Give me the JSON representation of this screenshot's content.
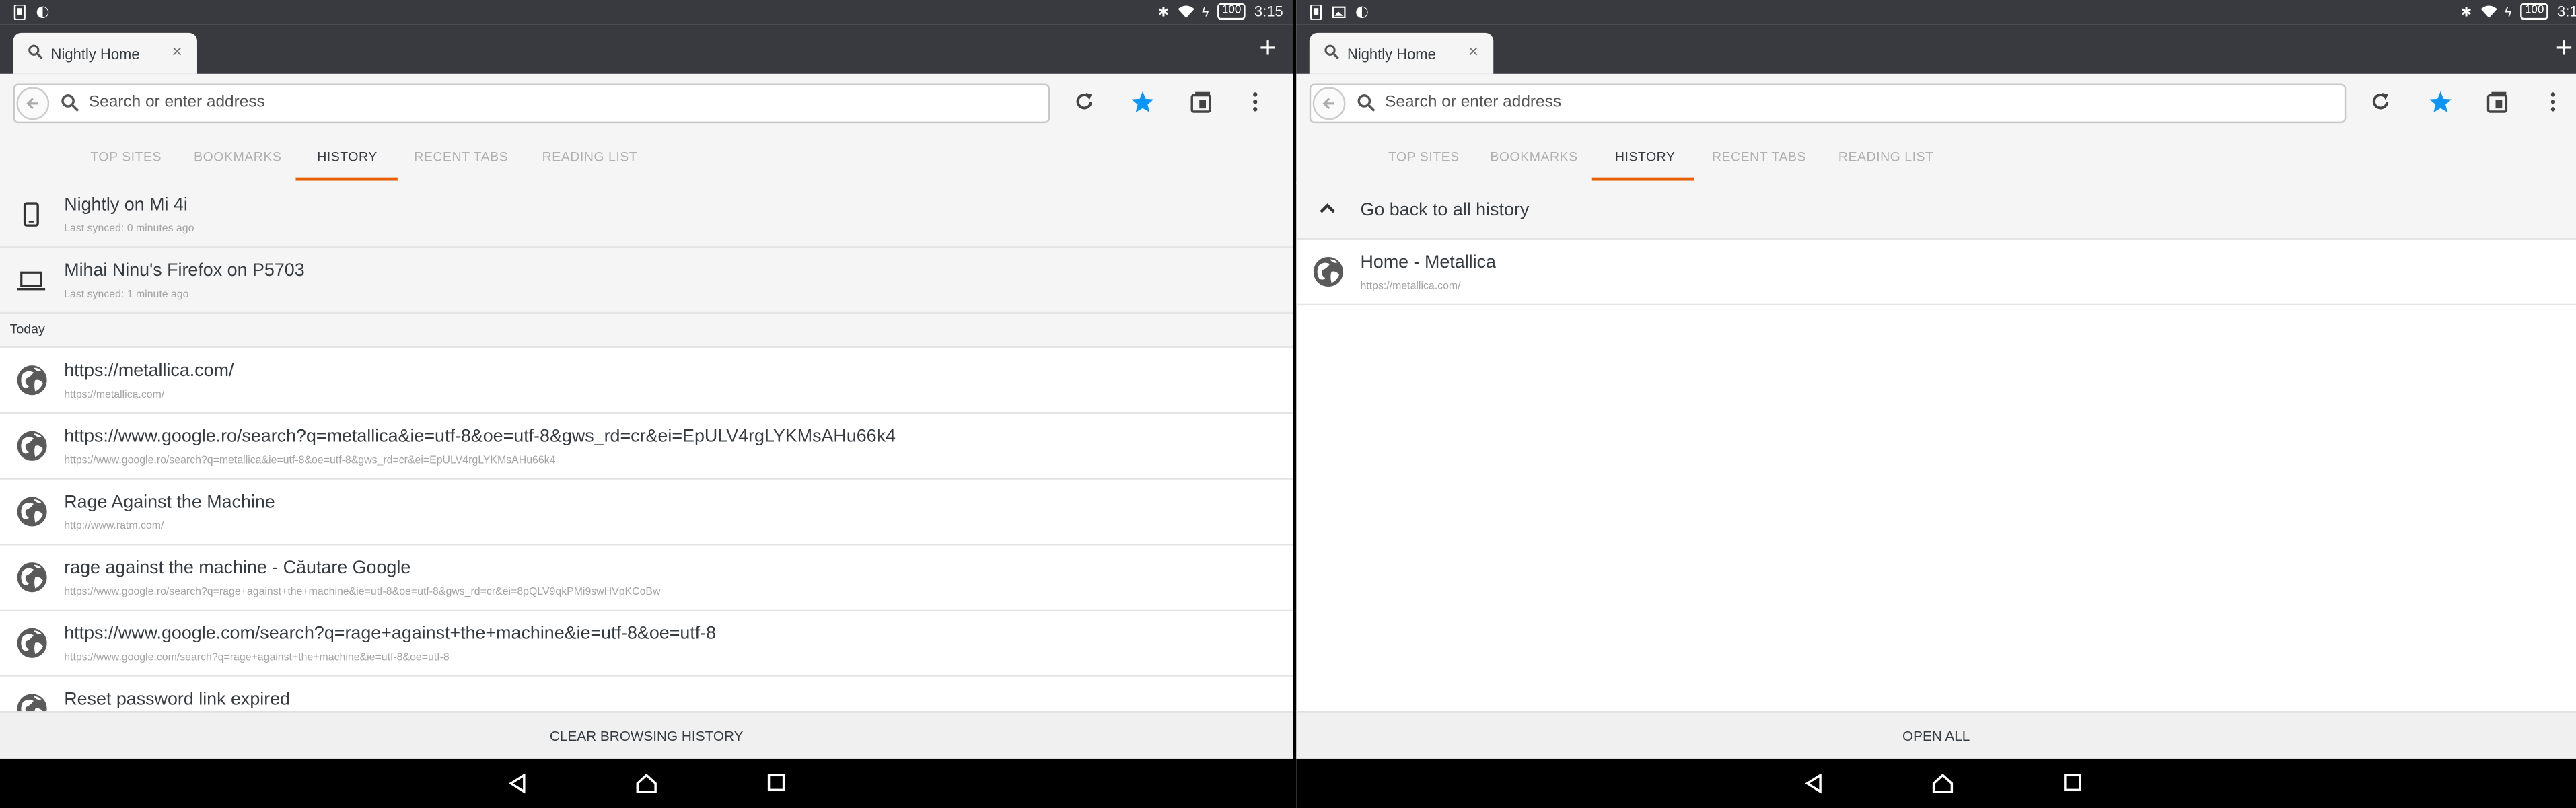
{
  "status": {
    "time": "3:15",
    "battery": "100"
  },
  "tab": {
    "title": "Nightly Home",
    "close_glyph": "×"
  },
  "new_tab_glyph": "+",
  "url": {
    "placeholder": "Search or enter address"
  },
  "panel_tabs": [
    "TOP SITES",
    "BOOKMARKS",
    "HISTORY",
    "RECENT TABS",
    "READING LIST"
  ],
  "active_panel_tab": "HISTORY",
  "left": {
    "devices": [
      {
        "name": "Nightly on Mi 4i",
        "synced": "Last synced: 0 minutes ago",
        "icon": "phone-icon"
      },
      {
        "name": "Mihai Ninu's Firefox on P5703",
        "synced": "Last synced: 1 minute ago",
        "icon": "laptop-icon"
      }
    ],
    "section": "Today",
    "history": [
      {
        "title": "https://metallica.com/",
        "url": "https://metallica.com/"
      },
      {
        "title": "https://www.google.ro/search?q=metallica&ie=utf-8&oe=utf-8&gws_rd=cr&ei=EpULV4rgLYKMsAHu66k4",
        "url": "https://www.google.ro/search?q=metallica&ie=utf-8&oe=utf-8&gws_rd=cr&ei=EpULV4rgLYKMsAHu66k4"
      },
      {
        "title": "Rage Against the Machine",
        "url": "http://www.ratm.com/"
      },
      {
        "title": "rage against the machine - Căutare Google",
        "url": "https://www.google.ro/search?q=rage+against+the+machine&ie=utf-8&oe=utf-8&gws_rd=cr&ei=8pQLV9qkPMi9swHVpKCoBw"
      },
      {
        "title": "https://www.google.com/search?q=rage+against+the+machine&ie=utf-8&oe=utf-8",
        "url": "https://www.google.com/search?q=rage+against+the+machine&ie=utf-8&oe=utf-8"
      },
      {
        "title": "Reset password link expired",
        "url": ""
      }
    ],
    "action_label": "CLEAR BROWSING HISTORY"
  },
  "right": {
    "go_back_label": "Go back to all history",
    "history": [
      {
        "title": "Home - Metallica",
        "url": "https://metallica.com/"
      }
    ],
    "action_label": "OPEN ALL"
  },
  "colors": {
    "chrome_dark": "#383a3f",
    "accent_orange": "#e66000",
    "star_blue": "#0996f8"
  }
}
